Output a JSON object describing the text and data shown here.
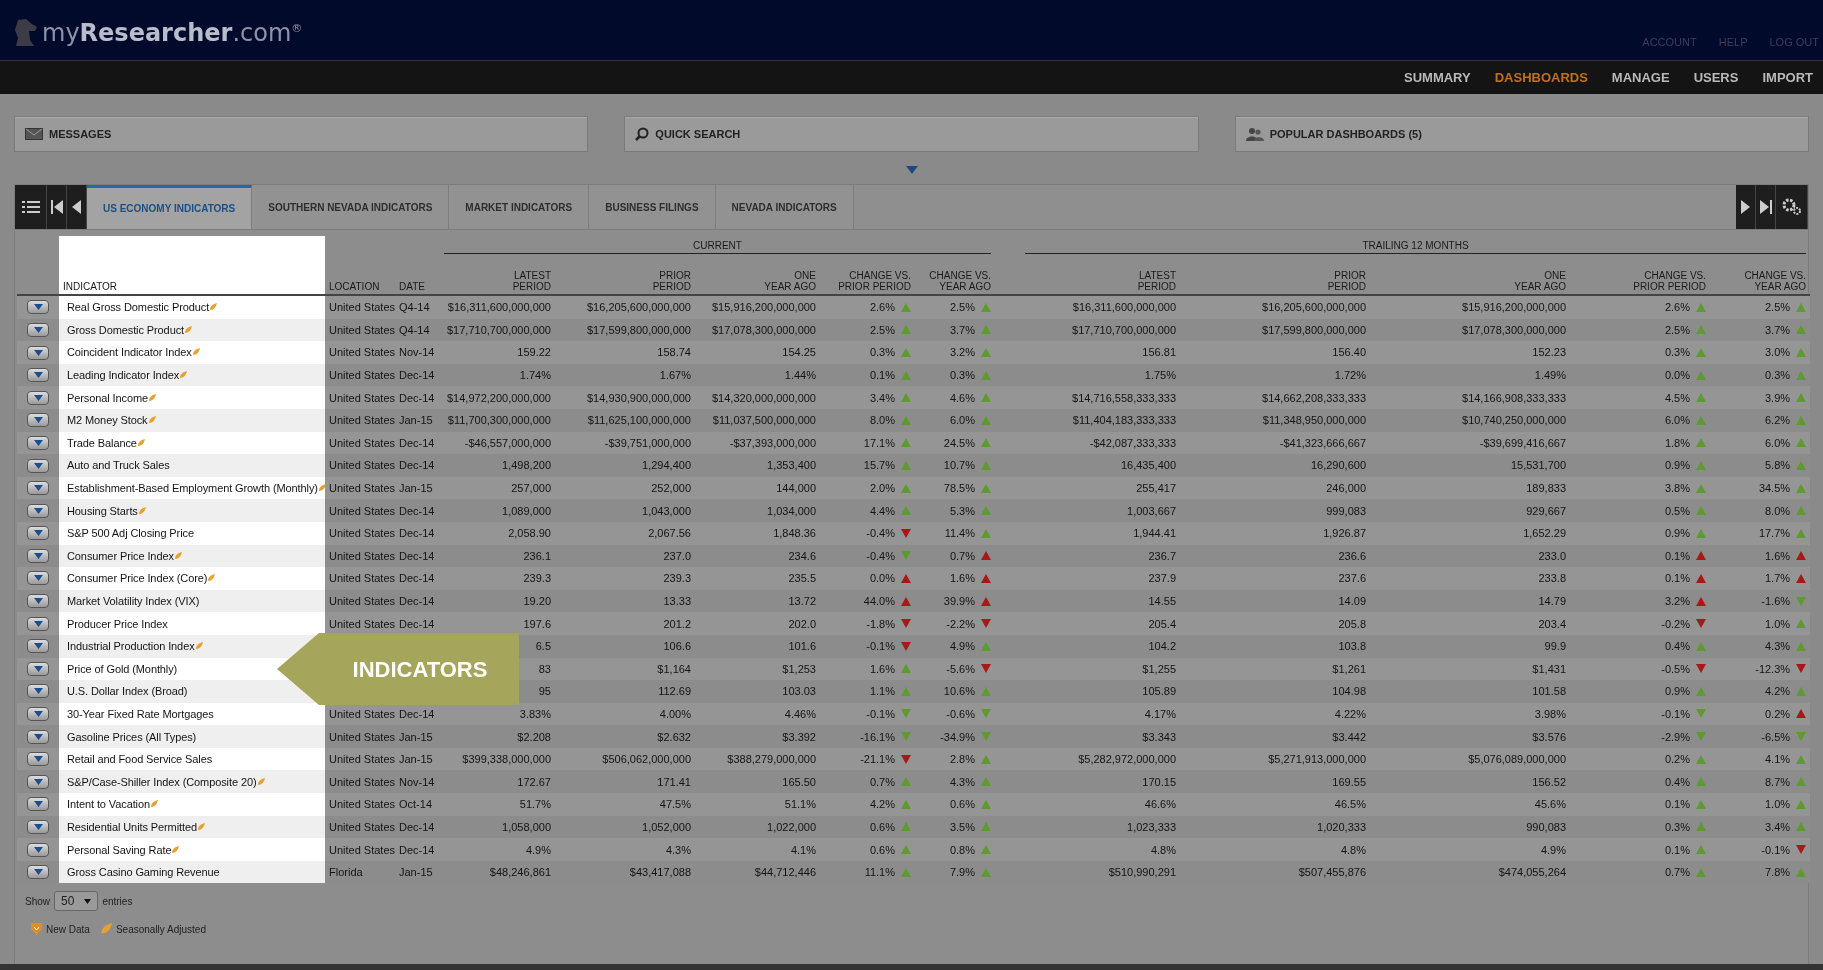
{
  "header": {
    "logo": "my**Researcher**.com$^{®}$",
    "links": [
      "ACCOUNT",
      "HELP",
      "LOG OUT"
    ]
  },
  "nav": [
    {
      "label": "SUMMARY",
      "selected": false
    },
    {
      "label": "DASHBOARDS",
      "selected": true
    },
    {
      "label": "MANAGE",
      "selected": false
    },
    {
      "label": "USERS",
      "selected": false
    },
    {
      "label": "IMPORT",
      "selected": false
    }
  ],
  "panels": [
    {
      "kind": "messages",
      "label": "MESSAGES"
    },
    {
      "kind": "search",
      "label": "QUICK SEARCH"
    },
    {
      "kind": "popular",
      "label": "POPULAR DASHBOARDS (5)"
    }
  ],
  "tabs": [
    {
      "label": "US ECONOMY INDICATORS",
      "selected": true
    },
    {
      "label": "SOUTHERN NEVADA INDICATORS",
      "selected": false
    },
    {
      "label": "MARKET INDICATORS",
      "selected": false
    },
    {
      "label": "BUSINESS FILINGS",
      "selected": false
    },
    {
      "label": "NEVADA INDICATORS",
      "selected": false
    }
  ],
  "table": {
    "groups": [
      "CURRENT",
      "TRAILING 12 MONTHS"
    ],
    "columns": {
      "indicator": "INDICATOR",
      "location": "LOCATION",
      "date": "DATE",
      "current": [
        [
          "LATEST",
          "PERIOD"
        ],
        [
          "PRIOR",
          "PERIOD"
        ],
        [
          "ONE",
          "YEAR AGO"
        ],
        [
          "CHANGE VS.",
          "PRIOR PERIOD"
        ],
        [
          "CHANGE VS.",
          "YEAR AGO"
        ]
      ],
      "trailing": [
        [
          "LATEST",
          "PERIOD"
        ],
        [
          "PRIOR",
          "PERIOD"
        ],
        [
          "ONE",
          "YEAR AGO"
        ],
        [
          "CHANGE VS.",
          "PRIOR PERIOD"
        ],
        [
          "CHANGE VS.",
          "YEAR AGO"
        ]
      ]
    },
    "rows": [
      {
        "indicator": "Real Gross Domestic Product",
        "seasonally_adjusted": true,
        "location": "United States",
        "date": "Q4-14",
        "current": [
          "$16,311,600,000,000",
          "$16,205,600,000,000",
          "$15,916,200,000,000"
        ],
        "current_changes": [
          {
            "value": "2.6%",
            "rising": true,
            "color": "#5e9a30"
          },
          {
            "value": "2.5%",
            "rising": true,
            "color": "#5e9a30"
          }
        ],
        "trailing": [
          "$16,311,600,000,000",
          "$16,205,600,000,000",
          "$15,916,200,000,000"
        ],
        "trailing_changes": [
          {
            "value": "2.6%",
            "rising": true,
            "color": "#5e9a30"
          },
          {
            "value": "2.5%",
            "rising": true,
            "color": "#5e9a30"
          }
        ]
      },
      {
        "indicator": "Gross Domestic Product",
        "seasonally_adjusted": true,
        "location": "United States",
        "date": "Q4-14",
        "current": [
          "$17,710,700,000,000",
          "$17,599,800,000,000",
          "$17,078,300,000,000"
        ],
        "current_changes": [
          {
            "value": "2.5%",
            "rising": true,
            "color": "#5e9a30"
          },
          {
            "value": "3.7%",
            "rising": true,
            "color": "#5e9a30"
          }
        ],
        "trailing": [
          "$17,710,700,000,000",
          "$17,599,800,000,000",
          "$17,078,300,000,000"
        ],
        "trailing_changes": [
          {
            "value": "2.5%",
            "rising": true,
            "color": "#5e9a30"
          },
          {
            "value": "3.7%",
            "rising": true,
            "color": "#5e9a30"
          }
        ]
      },
      {
        "indicator": "Coincident Indicator Index",
        "seasonally_adjusted": true,
        "location": "United States",
        "date": "Nov-14",
        "current": [
          "159.22",
          "158.74",
          "154.25"
        ],
        "current_changes": [
          {
            "value": "0.3%",
            "rising": true,
            "color": "#5e9a30"
          },
          {
            "value": "3.2%",
            "rising": true,
            "color": "#5e9a30"
          }
        ],
        "trailing": [
          "156.81",
          "156.40",
          "152.23"
        ],
        "trailing_changes": [
          {
            "value": "0.3%",
            "rising": true,
            "color": "#5e9a30"
          },
          {
            "value": "3.0%",
            "rising": true,
            "color": "#5e9a30"
          }
        ]
      },
      {
        "indicator": "Leading Indicator Index",
        "seasonally_adjusted": true,
        "location": "United States",
        "date": "Dec-14",
        "current": [
          "1.74%",
          "1.67%",
          "1.44%"
        ],
        "current_changes": [
          {
            "value": "0.1%",
            "rising": true,
            "color": "#5e9a30"
          },
          {
            "value": "0.3%",
            "rising": true,
            "color": "#5e9a30"
          }
        ],
        "trailing": [
          "1.75%",
          "1.72%",
          "1.49%"
        ],
        "trailing_changes": [
          {
            "value": "0.0%",
            "rising": true,
            "color": "#5e9a30"
          },
          {
            "value": "0.3%",
            "rising": true,
            "color": "#5e9a30"
          }
        ]
      },
      {
        "indicator": "Personal Income",
        "seasonally_adjusted": true,
        "location": "United States",
        "date": "Dec-14",
        "current": [
          "$14,972,200,000,000",
          "$14,930,900,000,000",
          "$14,320,000,000,000"
        ],
        "current_changes": [
          {
            "value": "3.4%",
            "rising": true,
            "color": "#5e9a30"
          },
          {
            "value": "4.6%",
            "rising": true,
            "color": "#5e9a30"
          }
        ],
        "trailing": [
          "$14,716,558,333,333",
          "$14,662,208,333,333",
          "$14,166,908,333,333"
        ],
        "trailing_changes": [
          {
            "value": "4.5%",
            "rising": true,
            "color": "#5e9a30"
          },
          {
            "value": "3.9%",
            "rising": true,
            "color": "#5e9a30"
          }
        ]
      },
      {
        "indicator": "M2 Money Stock",
        "seasonally_adjusted": true,
        "location": "United States",
        "date": "Jan-15",
        "current": [
          "$11,700,300,000,000",
          "$11,625,100,000,000",
          "$11,037,500,000,000"
        ],
        "current_changes": [
          {
            "value": "8.0%",
            "rising": true,
            "color": "#5e9a30"
          },
          {
            "value": "6.0%",
            "rising": true,
            "color": "#5e9a30"
          }
        ],
        "trailing": [
          "$11,404,183,333,333",
          "$11,348,950,000,000",
          "$10,740,250,000,000"
        ],
        "trailing_changes": [
          {
            "value": "6.0%",
            "rising": true,
            "color": "#5e9a30"
          },
          {
            "value": "6.2%",
            "rising": true,
            "color": "#5e9a30"
          }
        ]
      },
      {
        "indicator": "Trade Balance",
        "seasonally_adjusted": true,
        "location": "United States",
        "date": "Dec-14",
        "current": [
          "-$46,557,000,000",
          "-$39,751,000,000",
          "-$37,393,000,000"
        ],
        "current_changes": [
          {
            "value": "17.1%",
            "rising": true,
            "color": "#5e9a30"
          },
          {
            "value": "24.5%",
            "rising": true,
            "color": "#5e9a30"
          }
        ],
        "trailing": [
          "-$42,087,333,333",
          "-$41,323,666,667",
          "-$39,699,416,667"
        ],
        "trailing_changes": [
          {
            "value": "1.8%",
            "rising": true,
            "color": "#5e9a30"
          },
          {
            "value": "6.0%",
            "rising": true,
            "color": "#5e9a30"
          }
        ]
      },
      {
        "indicator": "Auto and Truck Sales",
        "seasonally_adjusted": false,
        "location": "United States",
        "date": "Dec-14",
        "current": [
          "1,498,200",
          "1,294,400",
          "1,353,400"
        ],
        "current_changes": [
          {
            "value": "15.7%",
            "rising": true,
            "color": "#5e9a30"
          },
          {
            "value": "10.7%",
            "rising": true,
            "color": "#5e9a30"
          }
        ],
        "trailing": [
          "16,435,400",
          "16,290,600",
          "15,531,700"
        ],
        "trailing_changes": [
          {
            "value": "0.9%",
            "rising": true,
            "color": "#5e9a30"
          },
          {
            "value": "5.8%",
            "rising": true,
            "color": "#5e9a30"
          }
        ]
      },
      {
        "indicator": "Establishment-Based Employment Growth (Monthly)",
        "seasonally_adjusted": true,
        "location": "United States",
        "date": "Jan-15",
        "current": [
          "257,000",
          "252,000",
          "144,000"
        ],
        "current_changes": [
          {
            "value": "2.0%",
            "rising": true,
            "color": "#5e9a30"
          },
          {
            "value": "78.5%",
            "rising": true,
            "color": "#5e9a30"
          }
        ],
        "trailing": [
          "255,417",
          "246,000",
          "189,833"
        ],
        "trailing_changes": [
          {
            "value": "3.8%",
            "rising": true,
            "color": "#5e9a30"
          },
          {
            "value": "34.5%",
            "rising": true,
            "color": "#5e9a30"
          }
        ]
      },
      {
        "indicator": "Housing Starts",
        "seasonally_adjusted": true,
        "location": "United States",
        "date": "Dec-14",
        "current": [
          "1,089,000",
          "1,043,000",
          "1,034,000"
        ],
        "current_changes": [
          {
            "value": "4.4%",
            "rising": true,
            "color": "#5e9a30"
          },
          {
            "value": "5.3%",
            "rising": true,
            "color": "#5e9a30"
          }
        ],
        "trailing": [
          "1,003,667",
          "999,083",
          "929,667"
        ],
        "trailing_changes": [
          {
            "value": "0.5%",
            "rising": true,
            "color": "#5e9a30"
          },
          {
            "value": "8.0%",
            "rising": true,
            "color": "#5e9a30"
          }
        ]
      },
      {
        "indicator": "S&P 500 Adj Closing Price",
        "seasonally_adjusted": false,
        "location": "United States",
        "date": "Dec-14",
        "current": [
          "2,058.90",
          "2,067.56",
          "1,848.36"
        ],
        "current_changes": [
          {
            "value": "-0.4%",
            "rising": false,
            "color": "#a81818"
          },
          {
            "value": "11.4%",
            "rising": true,
            "color": "#5e9a30"
          }
        ],
        "trailing": [
          "1,944.41",
          "1,926.87",
          "1,652.29"
        ],
        "trailing_changes": [
          {
            "value": "0.9%",
            "rising": true,
            "color": "#5e9a30"
          },
          {
            "value": "17.7%",
            "rising": true,
            "color": "#5e9a30"
          }
        ]
      },
      {
        "indicator": "Consumer Price Index",
        "seasonally_adjusted": true,
        "location": "United States",
        "date": "Dec-14",
        "current": [
          "236.1",
          "237.0",
          "234.6"
        ],
        "current_changes": [
          {
            "value": "-0.4%",
            "rising": false,
            "color": "#5e9a30"
          },
          {
            "value": "0.7%",
            "rising": true,
            "color": "#a81818"
          }
        ],
        "trailing": [
          "236.7",
          "236.6",
          "233.0"
        ],
        "trailing_changes": [
          {
            "value": "0.1%",
            "rising": true,
            "color": "#a81818"
          },
          {
            "value": "1.6%",
            "rising": true,
            "color": "#a81818"
          }
        ]
      },
      {
        "indicator": "Consumer Price Index (Core)",
        "seasonally_adjusted": true,
        "location": "United States",
        "date": "Dec-14",
        "current": [
          "239.3",
          "239.3",
          "235.5"
        ],
        "current_changes": [
          {
            "value": "0.0%",
            "rising": true,
            "color": "#a81818"
          },
          {
            "value": "1.6%",
            "rising": true,
            "color": "#a81818"
          }
        ],
        "trailing": [
          "237.9",
          "237.6",
          "233.8"
        ],
        "trailing_changes": [
          {
            "value": "0.1%",
            "rising": true,
            "color": "#a81818"
          },
          {
            "value": "1.7%",
            "rising": true,
            "color": "#a81818"
          }
        ]
      },
      {
        "indicator": "Market Volatility Index (VIX)",
        "seasonally_adjusted": false,
        "location": "United States",
        "date": "Dec-14",
        "current": [
          "19.20",
          "13.33",
          "13.72"
        ],
        "current_changes": [
          {
            "value": "44.0%",
            "rising": true,
            "color": "#a81818"
          },
          {
            "value": "39.9%",
            "rising": true,
            "color": "#a81818"
          }
        ],
        "trailing": [
          "14.55",
          "14.09",
          "14.79"
        ],
        "trailing_changes": [
          {
            "value": "3.2%",
            "rising": true,
            "color": "#a81818"
          },
          {
            "value": "-1.6%",
            "rising": false,
            "color": "#5e9a30"
          }
        ]
      },
      {
        "indicator": "Producer Price Index",
        "seasonally_adjusted": false,
        "location": "United States",
        "date": "Dec-14",
        "current": [
          "197.6",
          "201.2",
          "202.0"
        ],
        "current_changes": [
          {
            "value": "-1.8%",
            "rising": false,
            "color": "#a81818"
          },
          {
            "value": "-2.2%",
            "rising": false,
            "color": "#a81818"
          }
        ],
        "trailing": [
          "205.4",
          "205.8",
          "203.4"
        ],
        "trailing_changes": [
          {
            "value": "-0.2%",
            "rising": false,
            "color": "#a81818"
          },
          {
            "value": "1.0%",
            "rising": true,
            "color": "#5e9a30"
          }
        ]
      },
      {
        "indicator": "Industrial Production Index",
        "seasonally_adjusted": true,
        "current": [
          "6.5",
          "106.6",
          "101.6"
        ],
        "current_changes": [
          {
            "value": "-0.1%",
            "rising": false,
            "color": "#a81818"
          },
          {
            "value": "4.9%",
            "rising": true,
            "color": "#5e9a30"
          }
        ],
        "trailing": [
          "104.2",
          "103.8",
          "99.9"
        ],
        "trailing_changes": [
          {
            "value": "0.4%",
            "rising": true,
            "color": "#5e9a30"
          },
          {
            "value": "4.3%",
            "rising": true,
            "color": "#5e9a30"
          }
        ]
      },
      {
        "indicator": "Price of Gold (Monthly)",
        "seasonally_adjusted": false,
        "current": [
          "83",
          "$1,164",
          "$1,253"
        ],
        "current_changes": [
          {
            "value": "1.6%",
            "rising": true,
            "color": "#5e9a30"
          },
          {
            "value": "-5.6%",
            "rising": false,
            "color": "#a81818"
          }
        ],
        "trailing": [
          "$1,255",
          "$1,261",
          "$1,431"
        ],
        "trailing_changes": [
          {
            "value": "-0.5%",
            "rising": false,
            "color": "#a81818"
          },
          {
            "value": "-12.3%",
            "rising": false,
            "color": "#a81818"
          }
        ]
      },
      {
        "indicator": "U.S. Dollar Index (Broad)",
        "seasonally_adjusted": false,
        "current": [
          "95",
          "112.69",
          "103.03"
        ],
        "current_changes": [
          {
            "value": "1.1%",
            "rising": true,
            "color": "#5e9a30"
          },
          {
            "value": "10.6%",
            "rising": true,
            "color": "#5e9a30"
          }
        ],
        "trailing": [
          "105.89",
          "104.98",
          "101.58"
        ],
        "trailing_changes": [
          {
            "value": "0.9%",
            "rising": true,
            "color": "#5e9a30"
          },
          {
            "value": "4.2%",
            "rising": true,
            "color": "#5e9a30"
          }
        ]
      },
      {
        "indicator": "30-Year Fixed Rate Mortgages",
        "seasonally_adjusted": false,
        "location": "United States",
        "date": "Dec-14",
        "current": [
          "3.83%",
          "4.00%",
          "4.46%"
        ],
        "current_changes": [
          {
            "value": "-0.1%",
            "rising": false,
            "color": "#5e9a30"
          },
          {
            "value": "-0.6%",
            "rising": false,
            "color": "#5e9a30"
          }
        ],
        "trailing": [
          "4.17%",
          "4.22%",
          "3.98%"
        ],
        "trailing_changes": [
          {
            "value": "-0.1%",
            "rising": false,
            "color": "#5e9a30"
          },
          {
            "value": "0.2%",
            "rising": true,
            "color": "#a81818"
          }
        ]
      },
      {
        "indicator": "Gasoline Prices (All Types)",
        "seasonally_adjusted": false,
        "location": "United States",
        "date": "Jan-15",
        "current": [
          "$2.208",
          "$2.632",
          "$3.392"
        ],
        "current_changes": [
          {
            "value": "-16.1%",
            "rising": false,
            "color": "#5e9a30"
          },
          {
            "value": "-34.9%",
            "rising": false,
            "color": "#5e9a30"
          }
        ],
        "trailing": [
          "$3.343",
          "$3.442",
          "$3.576"
        ],
        "trailing_changes": [
          {
            "value": "-2.9%",
            "rising": false,
            "color": "#5e9a30"
          },
          {
            "value": "-6.5%",
            "rising": false,
            "color": "#5e9a30"
          }
        ]
      },
      {
        "indicator": "Retail and Food Service Sales",
        "seasonally_adjusted": false,
        "location": "United States",
        "date": "Jan-15",
        "current": [
          "$399,338,000,000",
          "$506,062,000,000",
          "$388,279,000,000"
        ],
        "current_changes": [
          {
            "value": "-21.1%",
            "rising": false,
            "color": "#a81818"
          },
          {
            "value": "2.8%",
            "rising": true,
            "color": "#5e9a30"
          }
        ],
        "trailing": [
          "$5,282,972,000,000",
          "$5,271,913,000,000",
          "$5,076,089,000,000"
        ],
        "trailing_changes": [
          {
            "value": "0.2%",
            "rising": true,
            "color": "#5e9a30"
          },
          {
            "value": "4.1%",
            "rising": true,
            "color": "#5e9a30"
          }
        ]
      },
      {
        "indicator": "S&P/Case-Shiller Index (Composite 20)",
        "seasonally_adjusted": true,
        "location": "United States",
        "date": "Nov-14",
        "current": [
          "172.67",
          "171.41",
          "165.50"
        ],
        "current_changes": [
          {
            "value": "0.7%",
            "rising": true,
            "color": "#5e9a30"
          },
          {
            "value": "4.3%",
            "rising": true,
            "color": "#5e9a30"
          }
        ],
        "trailing": [
          "170.15",
          "169.55",
          "156.52"
        ],
        "trailing_changes": [
          {
            "value": "0.4%",
            "rising": true,
            "color": "#5e9a30"
          },
          {
            "value": "8.7%",
            "rising": true,
            "color": "#5e9a30"
          }
        ]
      },
      {
        "indicator": "Intent to Vacation",
        "seasonally_adjusted": true,
        "location": "United States",
        "date": "Oct-14",
        "current": [
          "51.7%",
          "47.5%",
          "51.1%"
        ],
        "current_changes": [
          {
            "value": "4.2%",
            "rising": true,
            "color": "#5e9a30"
          },
          {
            "value": "0.6%",
            "rising": true,
            "color": "#5e9a30"
          }
        ],
        "trailing": [
          "46.6%",
          "46.5%",
          "45.6%"
        ],
        "trailing_changes": [
          {
            "value": "0.1%",
            "rising": true,
            "color": "#5e9a30"
          },
          {
            "value": "1.0%",
            "rising": true,
            "color": "#5e9a30"
          }
        ]
      },
      {
        "indicator": "Residential Units Permitted",
        "seasonally_adjusted": true,
        "location": "United States",
        "date": "Dec-14",
        "current": [
          "1,058,000",
          "1,052,000",
          "1,022,000"
        ],
        "current_changes": [
          {
            "value": "0.6%",
            "rising": true,
            "color": "#5e9a30"
          },
          {
            "value": "3.5%",
            "rising": true,
            "color": "#5e9a30"
          }
        ],
        "trailing": [
          "1,023,333",
          "1,020,333",
          "990,083"
        ],
        "trailing_changes": [
          {
            "value": "0.3%",
            "rising": true,
            "color": "#5e9a30"
          },
          {
            "value": "3.4%",
            "rising": true,
            "color": "#5e9a30"
          }
        ]
      },
      {
        "indicator": "Personal Saving Rate",
        "seasonally_adjusted": true,
        "location": "United States",
        "date": "Dec-14",
        "current": [
          "4.9%",
          "4.3%",
          "4.1%"
        ],
        "current_changes": [
          {
            "value": "0.6%",
            "rising": true,
            "color": "#5e9a30"
          },
          {
            "value": "0.8%",
            "rising": true,
            "color": "#5e9a30"
          }
        ],
        "trailing": [
          "4.8%",
          "4.8%",
          "4.9%"
        ],
        "trailing_changes": [
          {
            "value": "0.1%",
            "rising": true,
            "color": "#5e9a30"
          },
          {
            "value": "-0.1%",
            "rising": false,
            "color": "#a81818"
          }
        ]
      },
      {
        "indicator": "Gross Casino Gaming Revenue",
        "seasonally_adjusted": false,
        "location": "Florida",
        "date": "Jan-15",
        "current": [
          "$48,246,861",
          "$43,417,088",
          "$44,712,446"
        ],
        "current_changes": [
          {
            "value": "11.1%",
            "rising": true,
            "color": "#5e9a30"
          },
          {
            "value": "7.9%",
            "rising": true,
            "color": "#5e9a30"
          }
        ],
        "trailing": [
          "$510,990,291",
          "$507,455,876",
          "$474,055,264"
        ],
        "trailing_changes": [
          {
            "value": "0.7%",
            "rising": true,
            "color": "#5e9a30"
          },
          {
            "value": "7.8%",
            "rising": true,
            "color": "#5e9a30"
          }
        ]
      }
    ],
    "callout": {
      "label": "INDICATORS"
    }
  },
  "paging": {
    "show": "Show",
    "page_size": "50",
    "entries": "entries"
  },
  "legend": [
    {
      "kind": "new",
      "label": "New Data"
    },
    {
      "kind": "seasonal",
      "label": "Seasonally Adjusted"
    }
  ]
}
